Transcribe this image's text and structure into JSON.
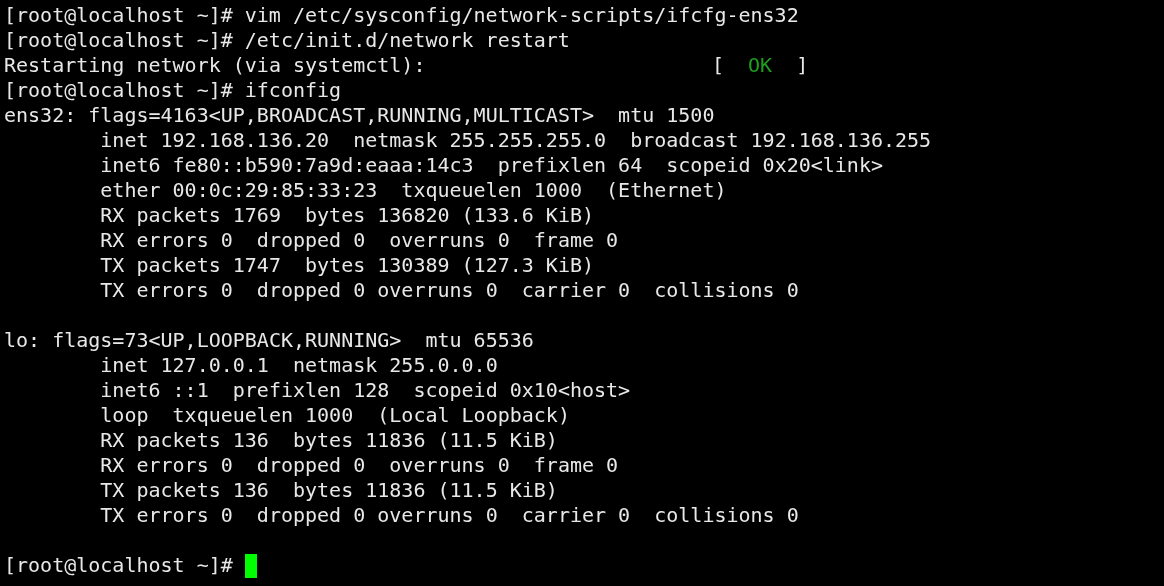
{
  "terminal": {
    "lines": [
      {
        "kind": "prompt",
        "prompt": "[root@localhost ~]#",
        "command": "vim /etc/sysconfig/network-scripts/ifcfg-ens32"
      },
      {
        "kind": "prompt",
        "prompt": "[root@localhost ~]#",
        "command": "/etc/init.d/network restart"
      },
      {
        "kind": "status",
        "text": "Restarting network (via systemctl):",
        "open": "[",
        "status": "OK",
        "close": "]"
      },
      {
        "kind": "prompt",
        "prompt": "[root@localhost ~]#",
        "command": "ifconfig"
      },
      {
        "kind": "output",
        "text": "ens32: flags=4163<UP,BROADCAST,RUNNING,MULTICAST>  mtu 1500"
      },
      {
        "kind": "output",
        "text": "        inet 192.168.136.20  netmask 255.255.255.0  broadcast 192.168.136.255"
      },
      {
        "kind": "output",
        "text": "        inet6 fe80::b590:7a9d:eaaa:14c3  prefixlen 64  scopeid 0x20<link>"
      },
      {
        "kind": "output",
        "text": "        ether 00:0c:29:85:33:23  txqueuelen 1000  (Ethernet)"
      },
      {
        "kind": "output",
        "text": "        RX packets 1769  bytes 136820 (133.6 KiB)"
      },
      {
        "kind": "output",
        "text": "        RX errors 0  dropped 0  overruns 0  frame 0"
      },
      {
        "kind": "output",
        "text": "        TX packets 1747  bytes 130389 (127.3 KiB)"
      },
      {
        "kind": "output",
        "text": "        TX errors 0  dropped 0 overruns 0  carrier 0  collisions 0"
      },
      {
        "kind": "blank"
      },
      {
        "kind": "output",
        "text": "lo: flags=73<UP,LOOPBACK,RUNNING>  mtu 65536"
      },
      {
        "kind": "output",
        "text": "        inet 127.0.0.1  netmask 255.0.0.0"
      },
      {
        "kind": "output",
        "text": "        inet6 ::1  prefixlen 128  scopeid 0x10<host>"
      },
      {
        "kind": "output",
        "text": "        loop  txqueuelen 1000  (Local Loopback)"
      },
      {
        "kind": "output",
        "text": "        RX packets 136  bytes 11836 (11.5 KiB)"
      },
      {
        "kind": "output",
        "text": "        RX errors 0  dropped 0  overruns 0  frame 0"
      },
      {
        "kind": "output",
        "text": "        TX packets 136  bytes 11836 (11.5 KiB)"
      },
      {
        "kind": "output",
        "text": "        TX errors 0  dropped 0 overruns 0  carrier 0  collisions 0"
      },
      {
        "kind": "blank"
      },
      {
        "kind": "prompt",
        "prompt": "[root@localhost ~]#",
        "cursor": true
      }
    ]
  }
}
